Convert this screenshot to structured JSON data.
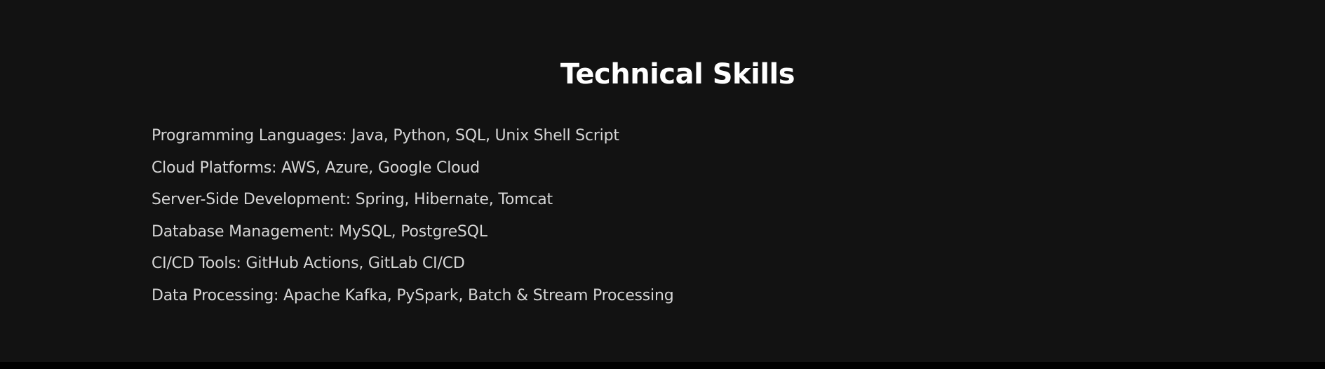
{
  "section": {
    "title": "Technical Skills",
    "skills": [
      "Programming Languages: Java, Python, SQL, Unix Shell Script",
      "Cloud Platforms: AWS, Azure, Google Cloud",
      "Server-Side Development: Spring, Hibernate, Tomcat",
      "Database Management: MySQL, PostgreSQL",
      "CI/CD Tools: GitHub Actions, GitLab CI/CD",
      "Data Processing: Apache Kafka, PySpark, Batch & Stream Processing"
    ]
  },
  "colors": {
    "background": "#121212",
    "title": "#ffffff",
    "text": "#d6d6d6"
  }
}
